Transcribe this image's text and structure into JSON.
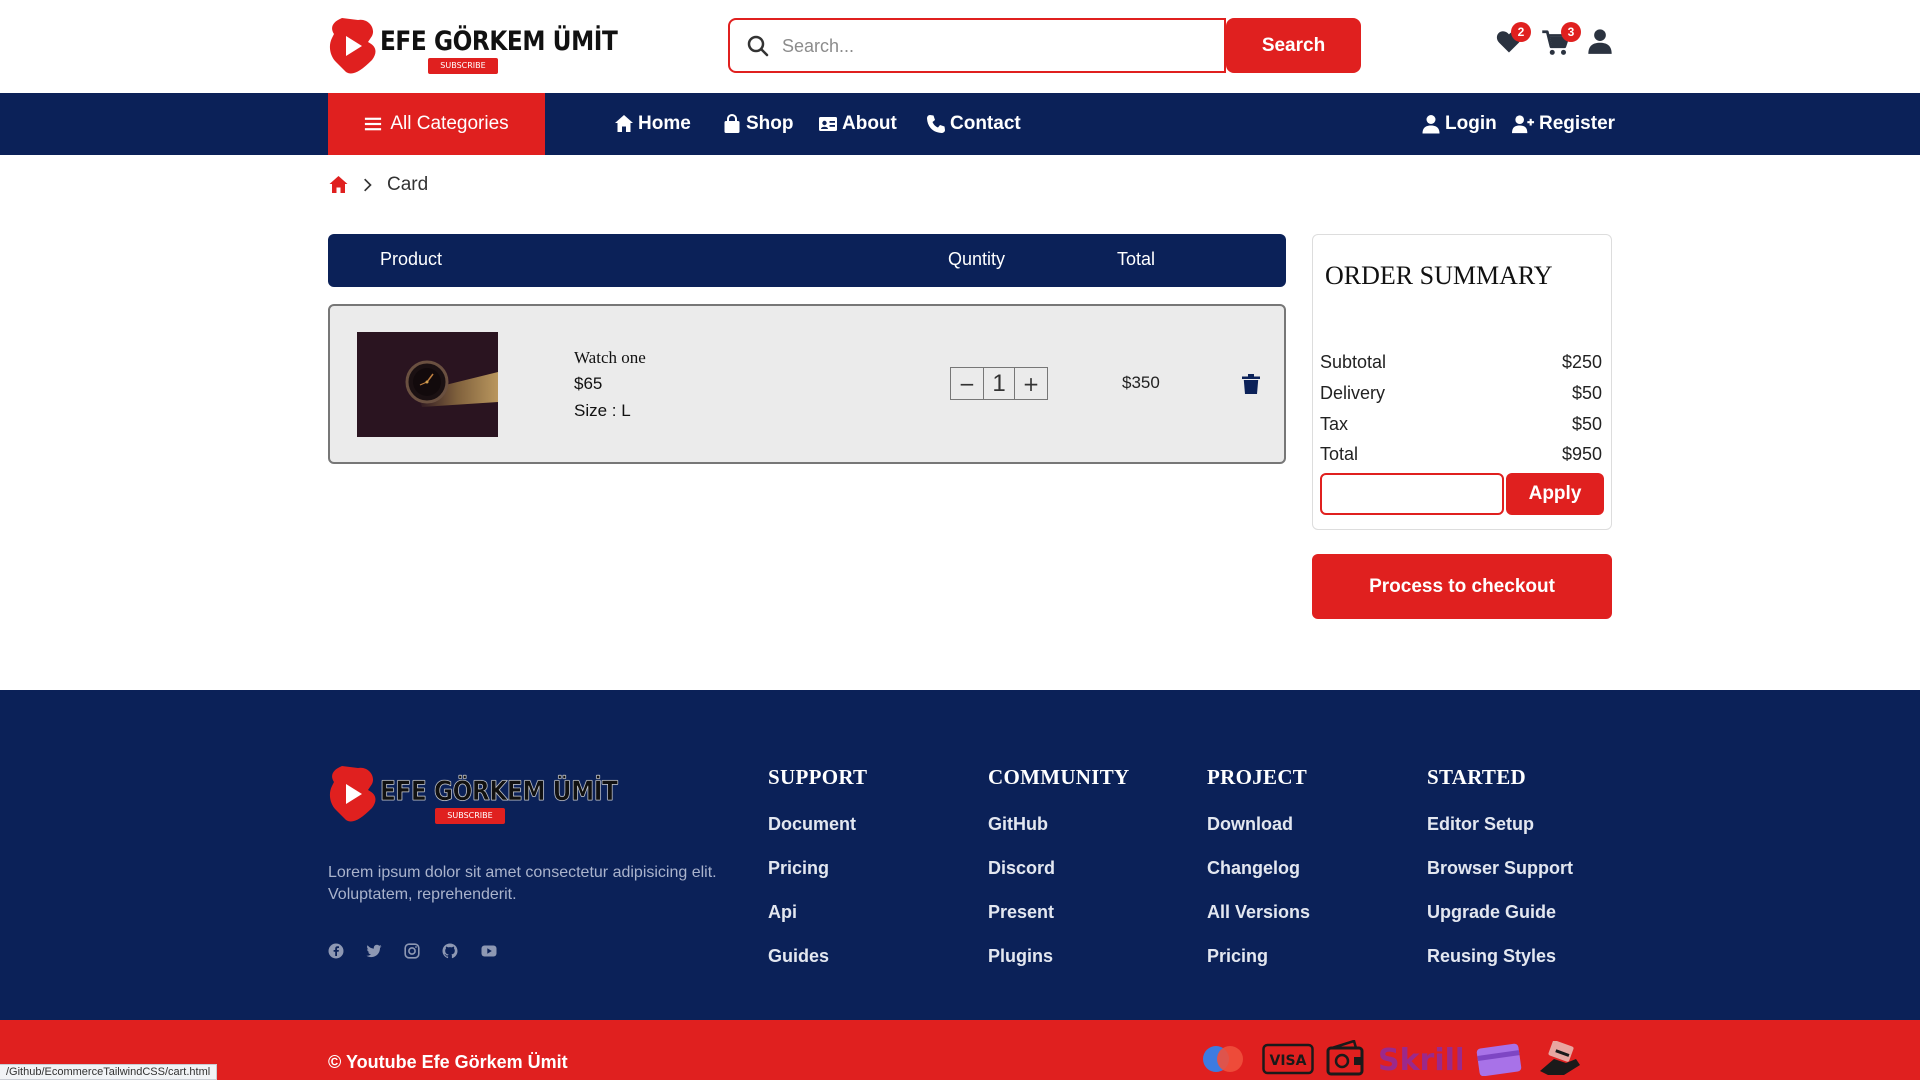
{
  "brand": {
    "name": "EFE GÖRKEM ÜMİT",
    "subscribe": "SUBSCRIBE",
    "colors": {
      "primary_red": "#e0201f",
      "navy": "#0b2158"
    }
  },
  "header": {
    "search_placeholder": "Search...",
    "search_button": "Search",
    "wishlist_count": "2",
    "cart_count": "3"
  },
  "nav": {
    "all_categories": "All Categories",
    "links": [
      "Home",
      "Shop",
      "About",
      "Contact"
    ],
    "login": "Login",
    "register": "Register"
  },
  "breadcrumb": {
    "current": "Card"
  },
  "cart": {
    "headers": {
      "product": "Product",
      "quantity": "Quntity",
      "total": "Total"
    },
    "items": [
      {
        "name": "Watch one",
        "price": "$65",
        "size": "Size : L",
        "quantity": "1",
        "total": "$350"
      }
    ]
  },
  "summary": {
    "title": "ORDER SUMMARY",
    "lines": [
      {
        "label": "Subtotal",
        "value": "$250"
      },
      {
        "label": "Delivery",
        "value": "$50"
      },
      {
        "label": "Tax",
        "value": "$50"
      },
      {
        "label": "Total",
        "value": "$950"
      }
    ],
    "coupon_value": "",
    "apply": "Apply",
    "checkout": "Process to checkout"
  },
  "footer": {
    "description": "Lorem ipsum dolor sit amet consectetur adipisicing elit. Voluptatem, reprehenderit.",
    "socials": [
      "facebook-icon",
      "twitter-icon",
      "instagram-icon",
      "github-icon",
      "youtube-icon"
    ],
    "columns": [
      {
        "title": "SUPPORT",
        "links": [
          "Document",
          "Pricing",
          "Api",
          "Guides"
        ]
      },
      {
        "title": "COMMUNITY",
        "links": [
          "GitHub",
          "Discord",
          "Present",
          "Plugins"
        ]
      },
      {
        "title": "PROJECT",
        "links": [
          "Download",
          "Changelog",
          "All Versions",
          "Pricing"
        ]
      },
      {
        "title": "STARTED",
        "links": [
          "Editor Setup",
          "Browser Support",
          "Upgrade Guide",
          "Reusing Styles"
        ]
      }
    ],
    "copyright": "© Youtube Efe Görkem Ümit",
    "payments": [
      "mastercard-icon",
      "visa-icon",
      "wallet-icon",
      "skrill-icon",
      "card-icon",
      "payment-hand-icon"
    ]
  },
  "status_url": "/Github/EcommerceTailwindCSS/cart.html"
}
